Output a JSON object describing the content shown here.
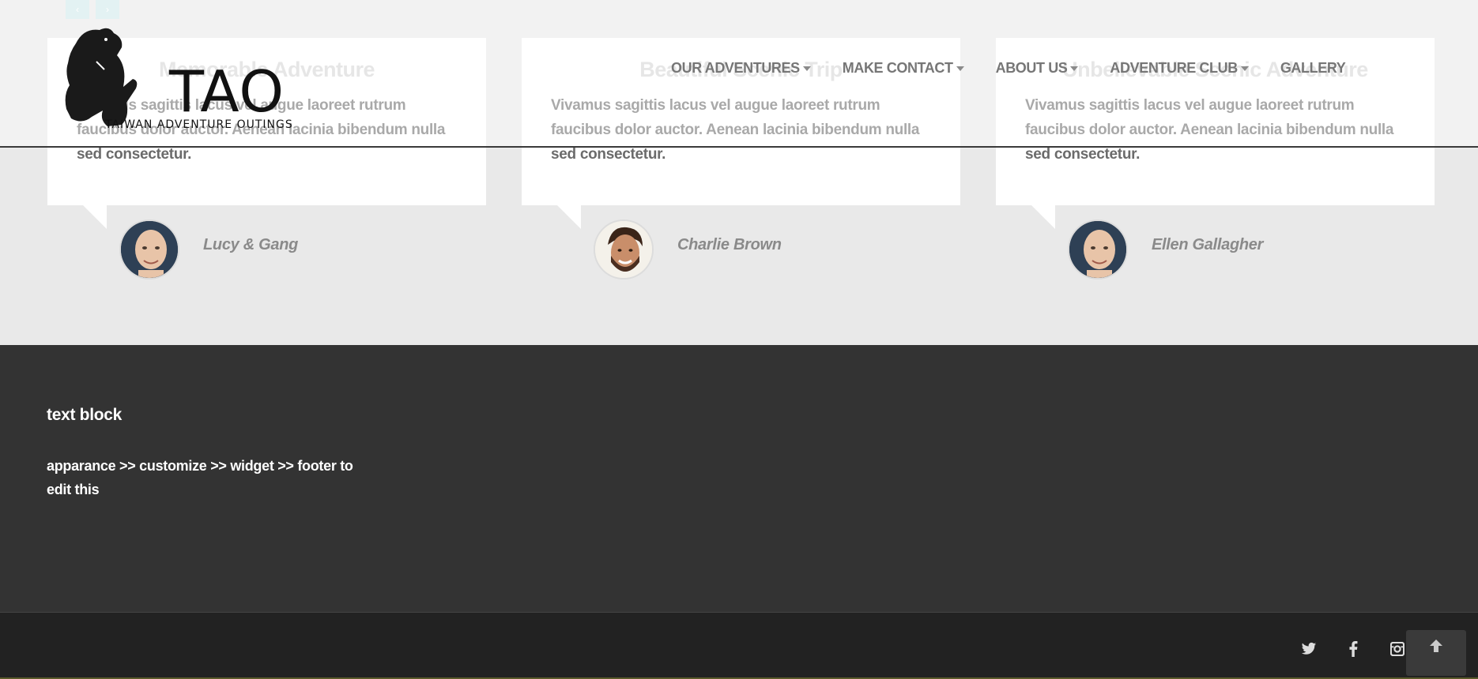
{
  "slider": {
    "prev_glyph": "‹",
    "next_glyph": "›"
  },
  "testimonials": [
    {
      "title": "Memorable Adventure",
      "text": "Vivamus sagittis lacus vel augue laoreet rutrum faucibus dolor auctor. Aenean lacinia bibendum nulla sed consectetur.",
      "author": "Lucy & Gang",
      "avatar_icon": "bald-man-avatar"
    },
    {
      "title": "Beautiful Scenic Trip",
      "text": "Vivamus sagittis lacus vel augue laoreet rutrum faucibus dolor auctor. Aenean lacinia bibendum nulla sed consectetur.",
      "author": "Charlie Brown",
      "avatar_icon": "smiling-man-avatar"
    },
    {
      "title": "Unbelievable Scenic Adventure",
      "text": "Vivamus sagittis lacus vel augue laoreet rutrum faucibus dolor auctor. Aenean lacinia bibendum nulla sed consectetur.",
      "author": "Ellen Gallagher",
      "avatar_icon": "bald-man-avatar"
    }
  ],
  "header": {
    "logo_title": "TAO",
    "logo_subtitle": "TAIWAN ADVENTURE OUTINGS",
    "nav": [
      {
        "label": "OUR ADVENTURES",
        "has_dropdown": true
      },
      {
        "label": "MAKE CONTACT",
        "has_dropdown": true
      },
      {
        "label": "ABOUT US",
        "has_dropdown": true
      },
      {
        "label": "ADVENTURE CLUB",
        "has_dropdown": true
      },
      {
        "label": "GALLERY",
        "has_dropdown": false
      }
    ]
  },
  "footer": {
    "widget_title": "text block",
    "widget_text": "apparance >> customize >> widget >> footer to edit this"
  },
  "social": [
    {
      "name": "twitter-icon"
    },
    {
      "name": "facebook-icon"
    },
    {
      "name": "instagram-icon"
    }
  ],
  "back_to_top_icon": "arrow-up-icon",
  "colors": {
    "testimonial_bg": "#e9e9e9",
    "footer_bg": "#333333",
    "bottom_bar_bg": "#222222",
    "nav_text": "#767676"
  }
}
